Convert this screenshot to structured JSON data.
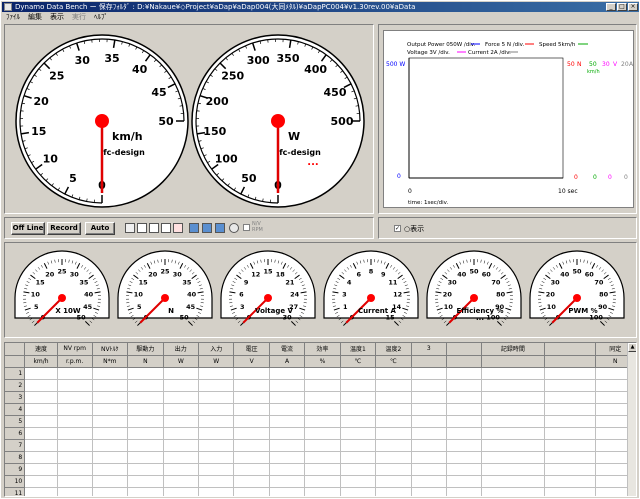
{
  "window": {
    "title": "Dynamo Data Bench  ー 保存ﾌｫﾙﾀﾞ : D:¥Nakaue¥◇Project¥aDap¥aDap004(大同ﾒﾀﾙ)¥aDapPC004¥v1.30rev.00¥aData",
    "minimize": "_",
    "maximize": "□",
    "close": "×"
  },
  "menu": [
    {
      "label": "ﾌｧｲﾙ",
      "disabled": false
    },
    {
      "label": "編集",
      "disabled": false
    },
    {
      "label": "表示",
      "disabled": false
    },
    {
      "label": "実行",
      "disabled": true
    },
    {
      "label": "ﾍﾙﾌﾟ",
      "disabled": false
    }
  ],
  "big_gauges": [
    {
      "unit": "km/h",
      "brand": "fc-design",
      "ticks": [
        "0",
        "5",
        "10",
        "15",
        "20",
        "25",
        "30",
        "35",
        "40",
        "45",
        "50"
      ],
      "value": 0,
      "max": 50,
      "dots": ""
    },
    {
      "unit": "W",
      "brand": "fc-design",
      "ticks": [
        "0",
        "50",
        "100",
        "150",
        "200",
        "250",
        "300",
        "350",
        "400",
        "450",
        "500"
      ],
      "value": 0,
      "max": 500,
      "dots": "..."
    }
  ],
  "graph": {
    "legend_row1": [
      "Output Power 050W /div.",
      "Force   5 N /div.",
      "Speed   5km/h"
    ],
    "legend_row2": [
      "Voltage  3V /div.",
      "Current  2A /div."
    ],
    "legend_colors": [
      "#0000ff",
      "#ff0000",
      "#00aa00",
      "#ff00ff",
      "#808080"
    ],
    "left_max": "500 W",
    "left_min": "0",
    "right_max": [
      "50",
      "N",
      "50",
      "30",
      "V",
      "20",
      "A"
    ],
    "right_sub": "km/h",
    "right_min": [
      "0",
      "0",
      "0",
      "0"
    ],
    "x_start": "0",
    "x_end": "10 sec",
    "time_label": "time: 1sec/div."
  },
  "toolbar": {
    "offline": "Off Line",
    "record": "Record",
    "auto": "Auto",
    "nv_label": "N/V\nRPM"
  },
  "check_panel": {
    "label": "○表示",
    "checked": true
  },
  "small_gauges": [
    {
      "label": "X 10W",
      "ticks": [
        "0",
        "5",
        "10",
        "15",
        "20",
        "25",
        "30",
        "35",
        "40",
        "45",
        "50"
      ],
      "value": 0,
      "dots": ""
    },
    {
      "label": "N",
      "ticks": [
        "0",
        "5",
        "10",
        "15",
        "20",
        "25",
        "30",
        "35",
        "40",
        "45",
        "50"
      ],
      "value": 0,
      "dots": ""
    },
    {
      "label": "Voltage V",
      "ticks": [
        "0",
        "3",
        "6",
        "9",
        "12",
        "15",
        "18",
        "21",
        "24",
        "27",
        "30"
      ],
      "value": 0,
      "dots": ""
    },
    {
      "label": "Current A",
      "ticks": [
        "0",
        "1",
        "3",
        "4",
        "6",
        "8",
        "9",
        "11",
        "12",
        "14",
        "15"
      ],
      "value": 0,
      "dots": ""
    },
    {
      "label": "Efficiency %",
      "ticks": [
        "0",
        "10",
        "20",
        "30",
        "40",
        "50",
        "60",
        "70",
        "80",
        "90",
        "100"
      ],
      "value": 0,
      "dots": "..."
    },
    {
      "label": "PWM %",
      "ticks": [
        "0",
        "10",
        "20",
        "30",
        "40",
        "50",
        "60",
        "70",
        "80",
        "90",
        "100"
      ],
      "value": 0,
      "dots": ""
    }
  ],
  "table": {
    "headers": [
      "速度",
      "NV rpm",
      "NVﾄﾙｸ",
      "駆動力",
      "出力",
      "入力",
      "電圧",
      "電流",
      "効率",
      "温度1",
      "温度2",
      "3",
      "",
      "記録時間",
      "",
      "同定"
    ],
    "units": [
      "km/h",
      "r.p.m.",
      "N*m",
      "N",
      "W",
      "W",
      "V",
      "A",
      "%",
      "℃",
      "℃",
      "",
      "",
      "",
      "",
      "N"
    ],
    "rows": [
      "1",
      "2",
      "3",
      "4",
      "5",
      "6",
      "7",
      "8",
      "9",
      "10",
      "11"
    ]
  },
  "colors": {
    "needle": "#e00000",
    "hub": "#ff0000",
    "blue_axis": "#0000ff",
    "red_axis": "#ff0000",
    "green_axis": "#00aa00",
    "magenta_axis": "#ff00ff",
    "gray_axis": "#808080"
  }
}
